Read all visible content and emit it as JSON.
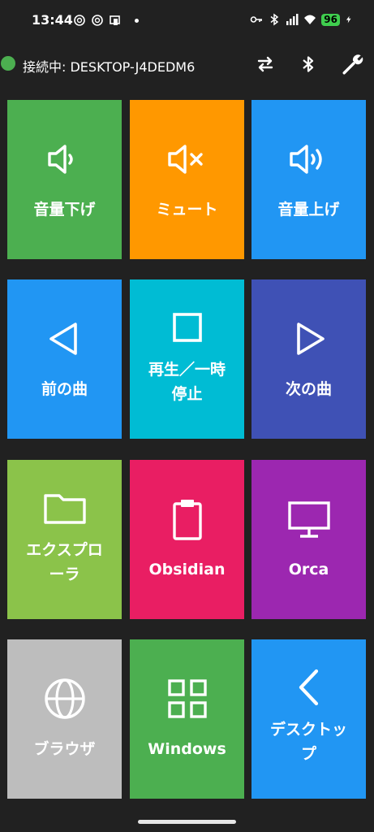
{
  "status_bar": {
    "time": "13:44",
    "battery": "96"
  },
  "toolbar": {
    "connection_text": "接続中: DESKTOP-J4DEDM6",
    "connection_color": "#4caf50"
  },
  "tiles": [
    {
      "label": "音量下げ",
      "icon": "volume-down-icon",
      "color": "#4caf50"
    },
    {
      "label": "ミュート",
      "icon": "volume-mute-icon",
      "color": "#ff9800"
    },
    {
      "label": "音量上げ",
      "icon": "volume-up-icon",
      "color": "#2196f3"
    },
    {
      "label": "前の曲",
      "icon": "previous-icon",
      "color": "#2196f3"
    },
    {
      "label": "再生／一時停止",
      "icon": "play-pause-icon",
      "color": "#00bcd4"
    },
    {
      "label": "次の曲",
      "icon": "next-icon",
      "color": "#3f51b5"
    },
    {
      "label": "エクスプローラ",
      "icon": "folder-icon",
      "color": "#8bc34a"
    },
    {
      "label": "Obsidian",
      "icon": "clipboard-icon",
      "color": "#e91e63"
    },
    {
      "label": "Orca",
      "icon": "monitor-icon",
      "color": "#9c27b0"
    },
    {
      "label": "ブラウザ",
      "icon": "globe-icon",
      "color": "#bdbdbd"
    },
    {
      "label": "Windows",
      "icon": "windows-grid-icon",
      "color": "#4caf50"
    },
    {
      "label": "デスクトップ",
      "icon": "chevron-left-icon",
      "color": "#2196f3"
    }
  ]
}
